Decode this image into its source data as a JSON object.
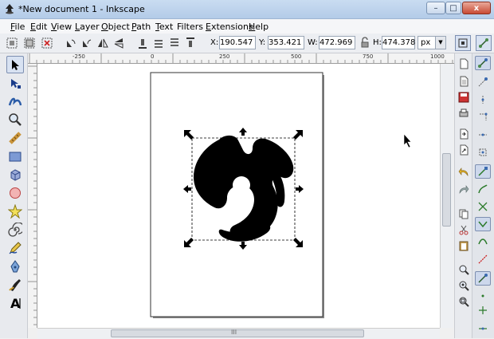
{
  "window": {
    "title": "*New document 1 - Inkscape",
    "minimize_label": "–",
    "maximize_label": "□",
    "close_label": "x"
  },
  "menu": [
    {
      "accel": "F",
      "rest": "ile"
    },
    {
      "accel": "E",
      "rest": "dit"
    },
    {
      "accel": "V",
      "rest": "iew"
    },
    {
      "accel": "L",
      "rest": "ayer"
    },
    {
      "accel": "O",
      "rest": "bject"
    },
    {
      "accel": "P",
      "rest": "ath"
    },
    {
      "accel": "T",
      "rest": "ext"
    },
    {
      "accel": "",
      "rest": "Filters"
    },
    {
      "accel": "E",
      "rest": "xtensions"
    },
    {
      "accel": "H",
      "rest": "elp"
    }
  ],
  "controls": {
    "x_label": "X:",
    "x_value": "190.547",
    "y_label": "Y:",
    "y_value": "353.421",
    "w_label": "W:",
    "w_value": "472.969",
    "h_label": "H:",
    "h_value": "474.378",
    "unit": "px"
  },
  "rulers": {
    "h_labels": [
      "-250",
      "0",
      "250",
      "500",
      "750",
      "1000"
    ]
  },
  "scrollbar_grip": "III",
  "tools": [
    "selector",
    "node",
    "tweak",
    "zoom",
    "measure",
    "rectangle",
    "3d-box",
    "ellipse",
    "star",
    "spiral",
    "pencil",
    "pen",
    "calligraphy",
    "text"
  ],
  "colors": {
    "accent": "#3c5a8a",
    "canvas": "#ffffff",
    "object_fill": "#000000"
  }
}
